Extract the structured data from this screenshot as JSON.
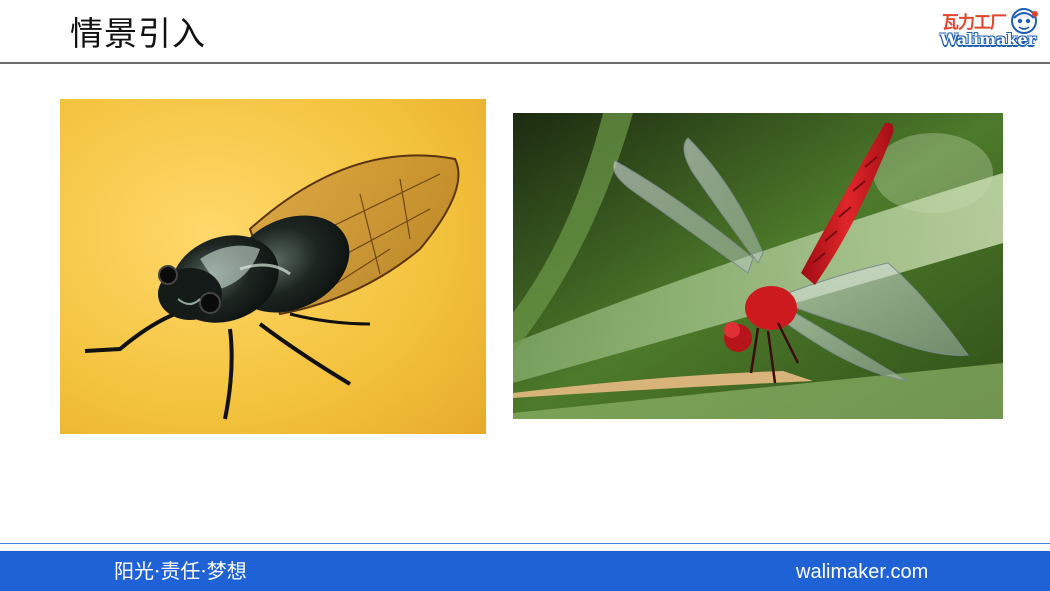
{
  "header": {
    "title": "情景引入",
    "logo": {
      "cn_text": "瓦力工厂",
      "en_text": "Walimaker",
      "brand_red": "#e2452b",
      "brand_blue": "#1d5fb4"
    }
  },
  "images": [
    {
      "subject": "cicada",
      "background": "#f3c23c"
    },
    {
      "subject": "dragonfly",
      "body_color": "#d9141b"
    }
  ],
  "footer": {
    "motto": "阳光·责任·梦想",
    "site": "walimaker.com",
    "bar_color": "#1f62d6"
  }
}
